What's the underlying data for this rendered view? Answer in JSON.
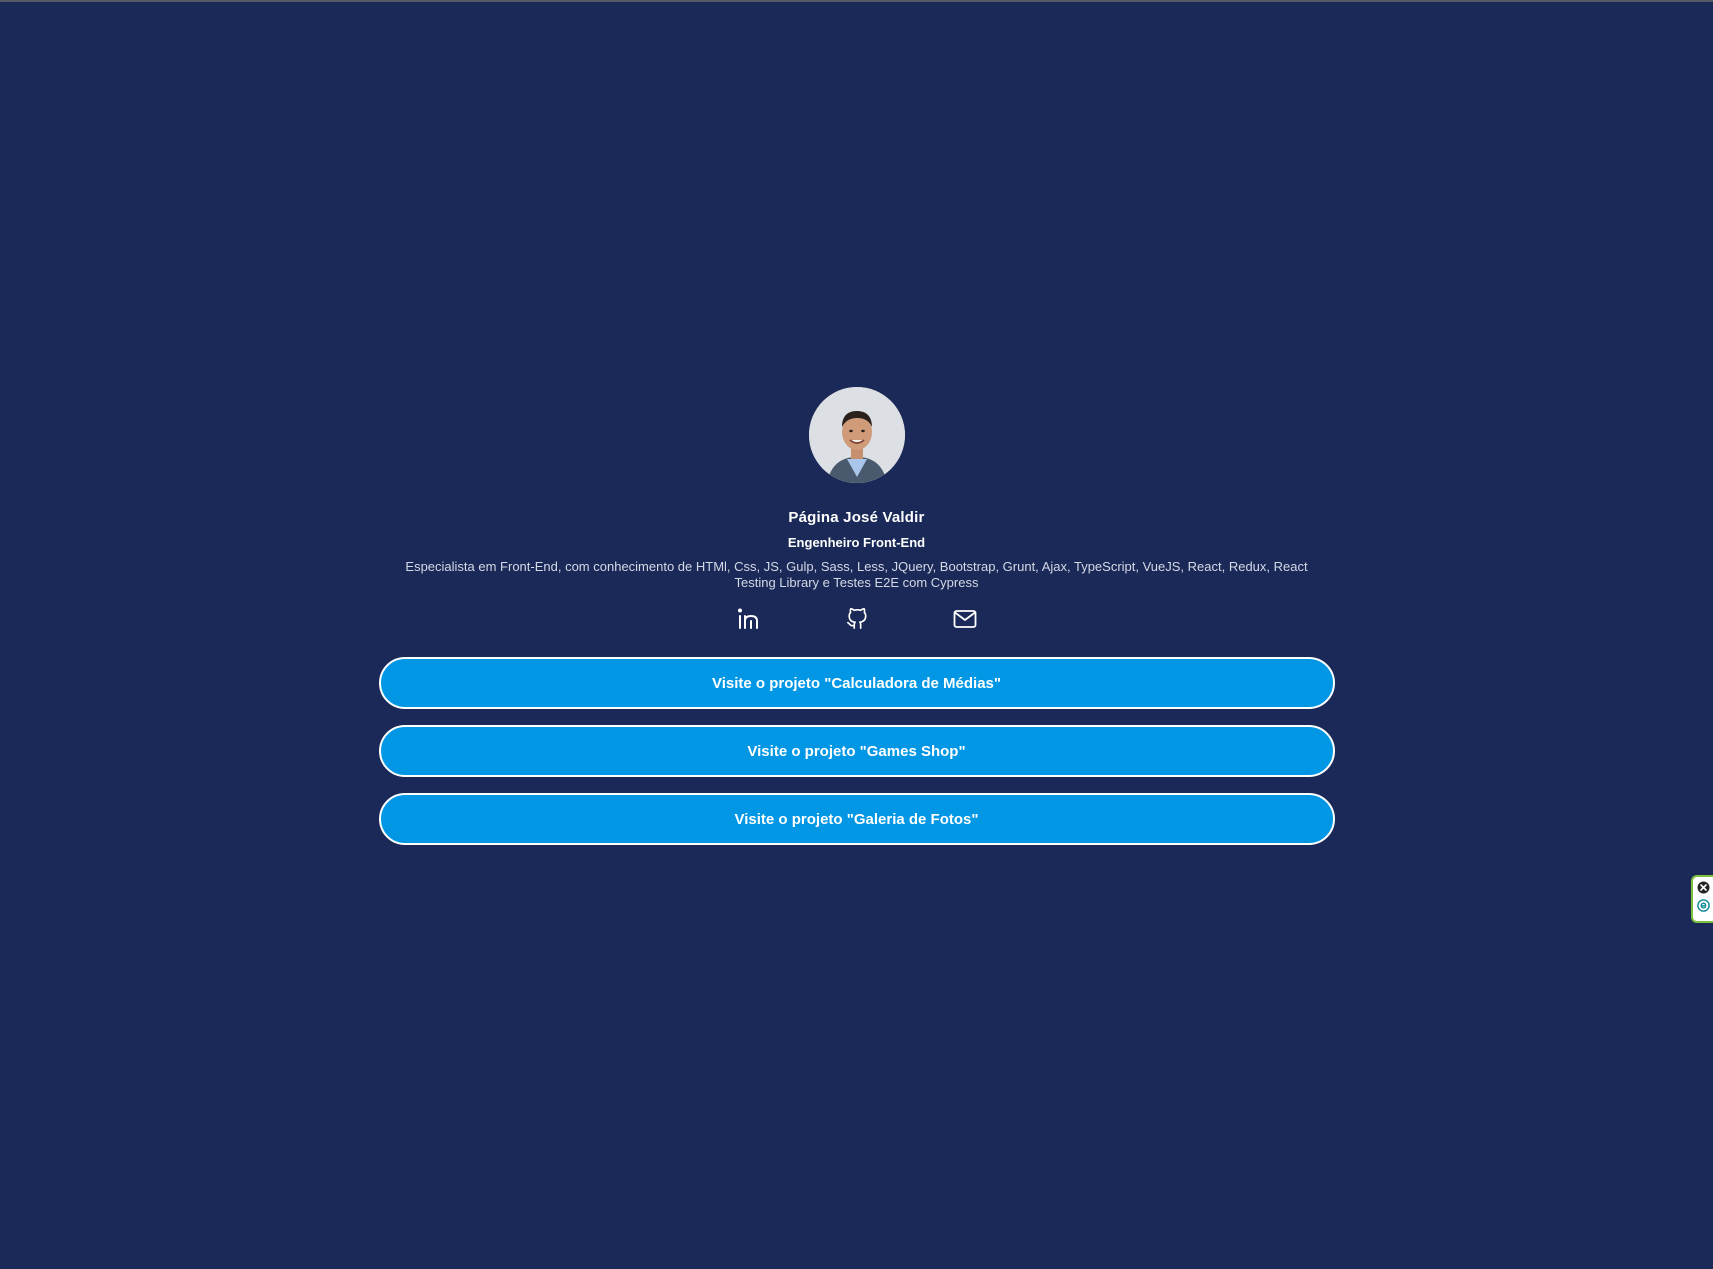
{
  "profile": {
    "name": "Página José Valdir",
    "role": "Engenheiro Front-End",
    "bio": "Especialista em Front-End, com conhecimento de HTMl, Css, JS, Gulp, Sass, Less, JQuery, Bootstrap, Grunt, Ajax, TypeScript, VueJS, React, Redux, React Testing Library e Testes E2E com Cypress"
  },
  "socials": [
    {
      "icon": "linkedin-icon"
    },
    {
      "icon": "github-icon"
    },
    {
      "icon": "mail-icon"
    }
  ],
  "links": [
    {
      "label": "Visite o projeto \"Calculadora de Médias\""
    },
    {
      "label": "Visite o projeto \"Games Shop\""
    },
    {
      "label": "Visite o projeto \"Galeria de Fotos\""
    }
  ],
  "colors": {
    "background": "#1a2957",
    "button": "#0197e5",
    "button_border": "#ffffff",
    "text": "#ffffff"
  }
}
